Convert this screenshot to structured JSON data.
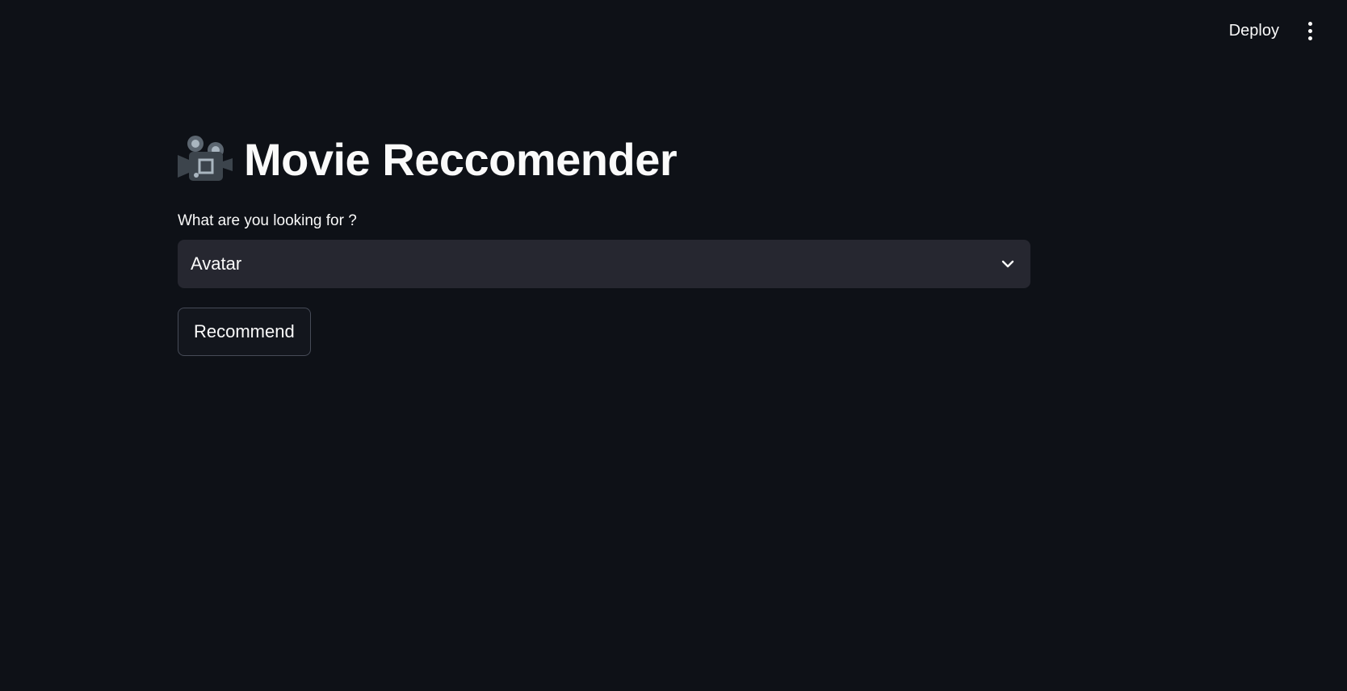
{
  "toolbar": {
    "deploy_label": "Deploy",
    "menu_icon": "kebab-menu-icon"
  },
  "main": {
    "title_icon": "movie-camera-icon",
    "title": "Movie Reccomender",
    "select": {
      "label": "What are you looking for ?",
      "value": "Avatar",
      "icon": "chevron-down-icon"
    },
    "recommend_label": "Recommend"
  },
  "colors": {
    "background": "#0e1117",
    "text": "#fafafa",
    "select_background": "#262730",
    "button_border": "#464b57"
  }
}
